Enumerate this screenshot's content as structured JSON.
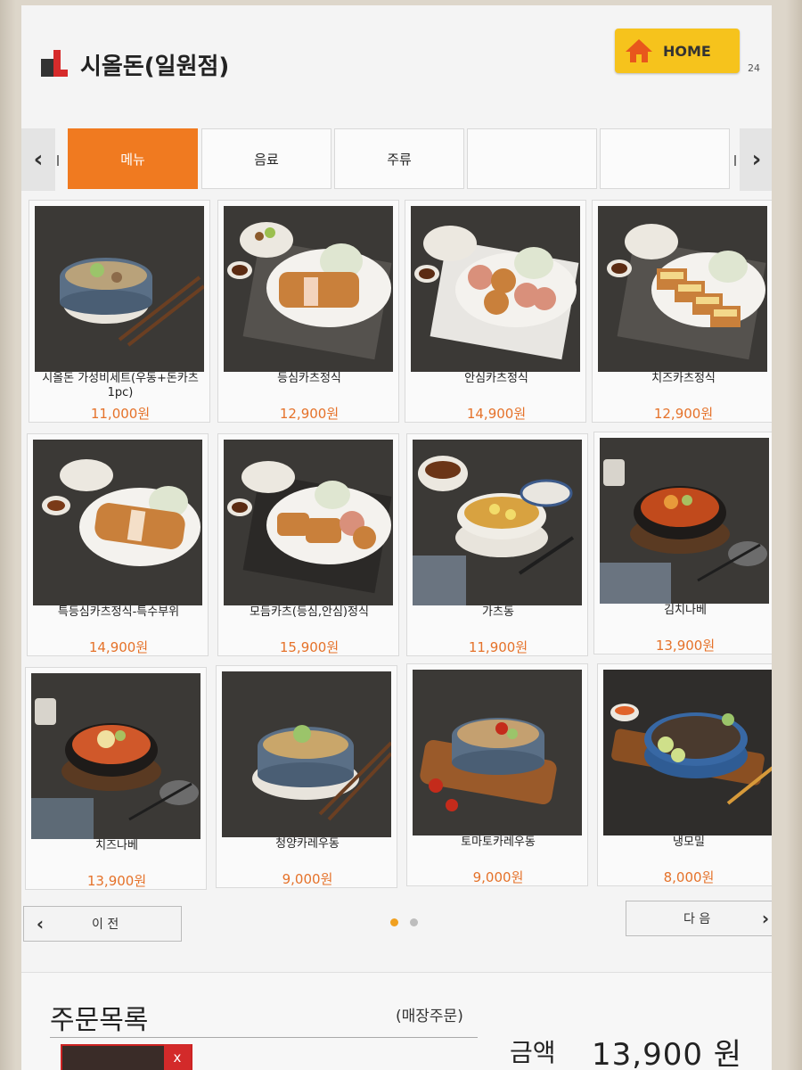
{
  "store": {
    "name": "시올돈(일원점)"
  },
  "home_button": {
    "label": "HOME"
  },
  "counter": "24",
  "tabs": [
    {
      "label": "메뉴",
      "active": true
    },
    {
      "label": "음료"
    },
    {
      "label": "주류"
    },
    {
      "label": ""
    },
    {
      "label": ""
    }
  ],
  "menu": [
    {
      "name": "시올돈 가성비세트(우동+돈카츠 1pc)",
      "price": "11,000원"
    },
    {
      "name": "등심카츠정식",
      "price": "12,900원"
    },
    {
      "name": "안심카츠정식",
      "price": "14,900원"
    },
    {
      "name": "치즈카츠정식",
      "price": "12,900원"
    },
    {
      "name": "특등심카츠정식-특수부위",
      "price": "14,900원"
    },
    {
      "name": "모듬카츠(등심,안심)정식",
      "price": "15,900원"
    },
    {
      "name": "가츠동",
      "price": "11,900원"
    },
    {
      "name": "김치나베",
      "price": "13,900원"
    },
    {
      "name": "치즈나베",
      "price": "13,900원"
    },
    {
      "name": "청양카레우동",
      "price": "9,000원"
    },
    {
      "name": "토마토카레우동",
      "price": "9,000원"
    },
    {
      "name": "냉모밀",
      "price": "8,000원"
    }
  ],
  "pager": {
    "prev_label": "이 전",
    "next_label": "다 음",
    "pages": 2,
    "current": 1
  },
  "order": {
    "title": "주문목록",
    "type": "(매장주문)",
    "remove_label": "x",
    "amount_label": "금액",
    "amount_value": "13,900 원"
  },
  "colors": {
    "accent": "#f07a20",
    "price": "#e5722a",
    "home": "#f6c31c",
    "remove": "#d32a2a"
  }
}
